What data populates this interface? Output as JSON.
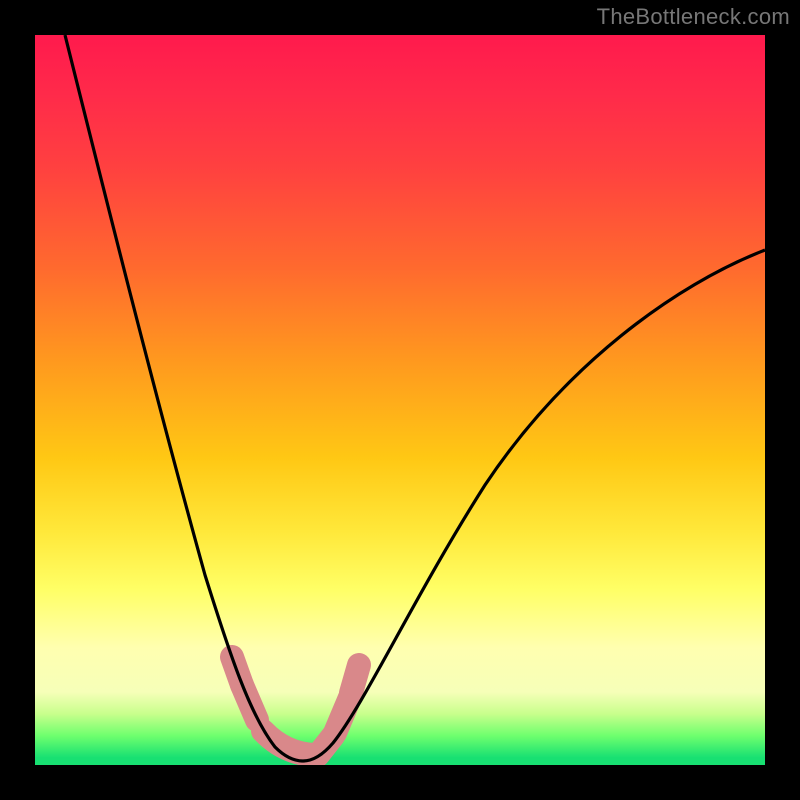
{
  "watermark": "TheBottleneck.com",
  "chart_data": {
    "type": "line",
    "title": "",
    "xlabel": "",
    "ylabel": "",
    "xlim": [
      0,
      100
    ],
    "ylim": [
      0,
      100
    ],
    "grid": false,
    "legend": false,
    "series": [
      {
        "name": "left-curve",
        "x": [
          4,
          8,
          12,
          16,
          20,
          24,
          27,
          29,
          30.5,
          32,
          34,
          36
        ],
        "y": [
          100,
          86,
          72,
          58,
          44,
          30,
          18,
          10,
          5,
          2,
          0.5,
          0
        ],
        "color": "#000000"
      },
      {
        "name": "right-curve",
        "x": [
          36,
          38,
          40,
          43,
          48,
          55,
          63,
          72,
          82,
          92,
          100
        ],
        "y": [
          0,
          0.8,
          3,
          9,
          20,
          33,
          44,
          53,
          60,
          66,
          70
        ],
        "color": "#000000"
      },
      {
        "name": "marker-band",
        "x": [
          28,
          29.5,
          31,
          33.5,
          36,
          38.5,
          40.5,
          42,
          43.5
        ],
        "y": [
          13,
          8.5,
          4.5,
          1.5,
          0.5,
          1.5,
          4.5,
          8.5,
          13
        ],
        "color": "#d9888a"
      }
    ],
    "colors": {
      "background_top": "#ff1a4d",
      "background_mid": "#ffe83a",
      "background_bottom": "#18e072",
      "curve": "#000000",
      "marker": "#d9888a",
      "frame": "#000000"
    }
  }
}
